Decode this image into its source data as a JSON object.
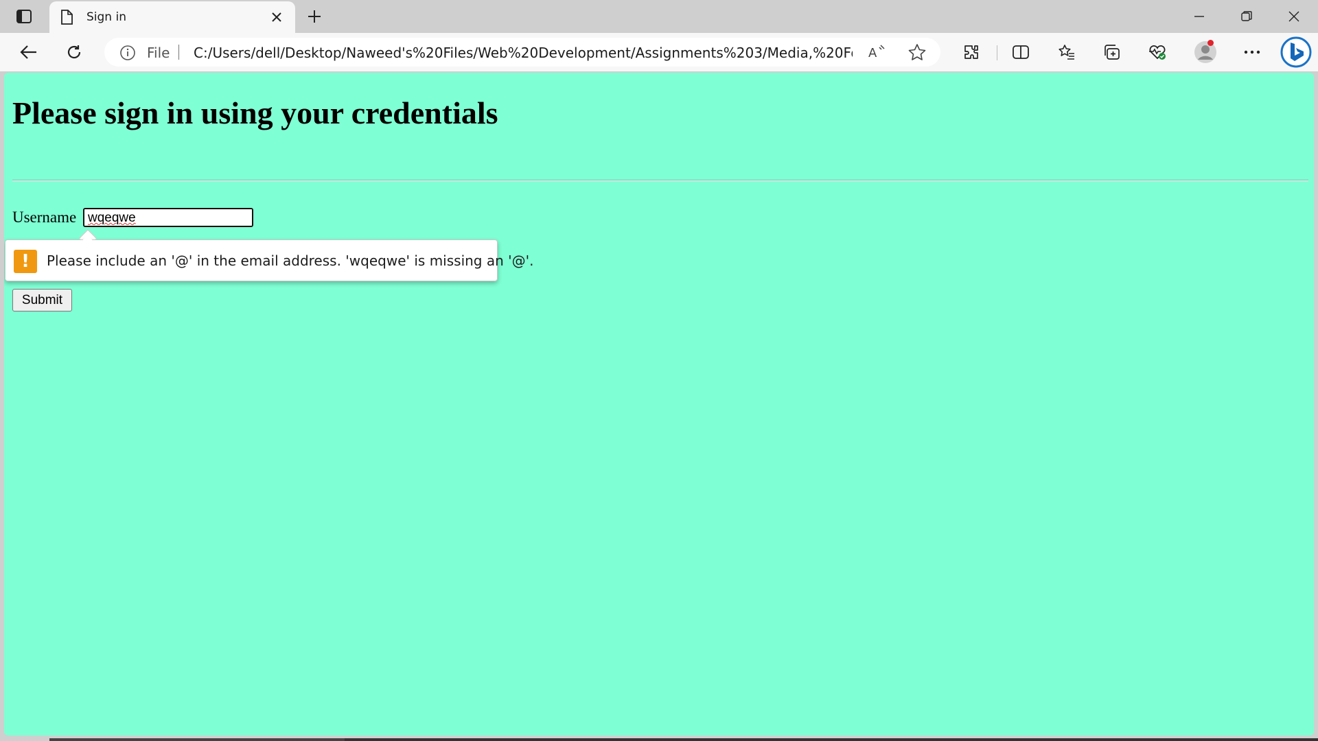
{
  "browser": {
    "tab": {
      "title": "Sign in"
    },
    "address_bar": {
      "scheme_label": "File",
      "url": "C:/Users/dell/Desktop/Naweed's%20Files/Web%20Development/Assignments%203/Media,%20Form,..."
    },
    "icons": {
      "tab_actions": "tab-actions-icon",
      "tab_page": "page-icon",
      "tab_close": "close-icon",
      "new_tab": "plus-icon",
      "minimize": "minimize-icon",
      "restore": "restore-icon",
      "close_window": "close-icon",
      "back": "back-arrow-icon",
      "refresh": "refresh-icon",
      "site_info": "info-icon",
      "read_aloud": "read-aloud-icon",
      "favorite": "star-icon",
      "extensions": "puzzle-icon",
      "split_screen": "split-screen-icon",
      "favorites": "favorites-list-icon",
      "collections": "collections-icon",
      "browser_essentials": "heart-pulse-icon",
      "profile": "profile-avatar-icon",
      "menu": "more-dots-icon",
      "copilot": "bing-copilot-icon"
    }
  },
  "page": {
    "background_color": "#7fffd4",
    "heading": "Please sign in using your credentials",
    "form": {
      "username_label": "Username",
      "username_value": "wqeqwe",
      "submit_label": "Submit"
    },
    "validation_tooltip": {
      "icon": "!",
      "message": "Please include an '@' in the email address. 'wqeqwe' is missing an '@'."
    }
  }
}
